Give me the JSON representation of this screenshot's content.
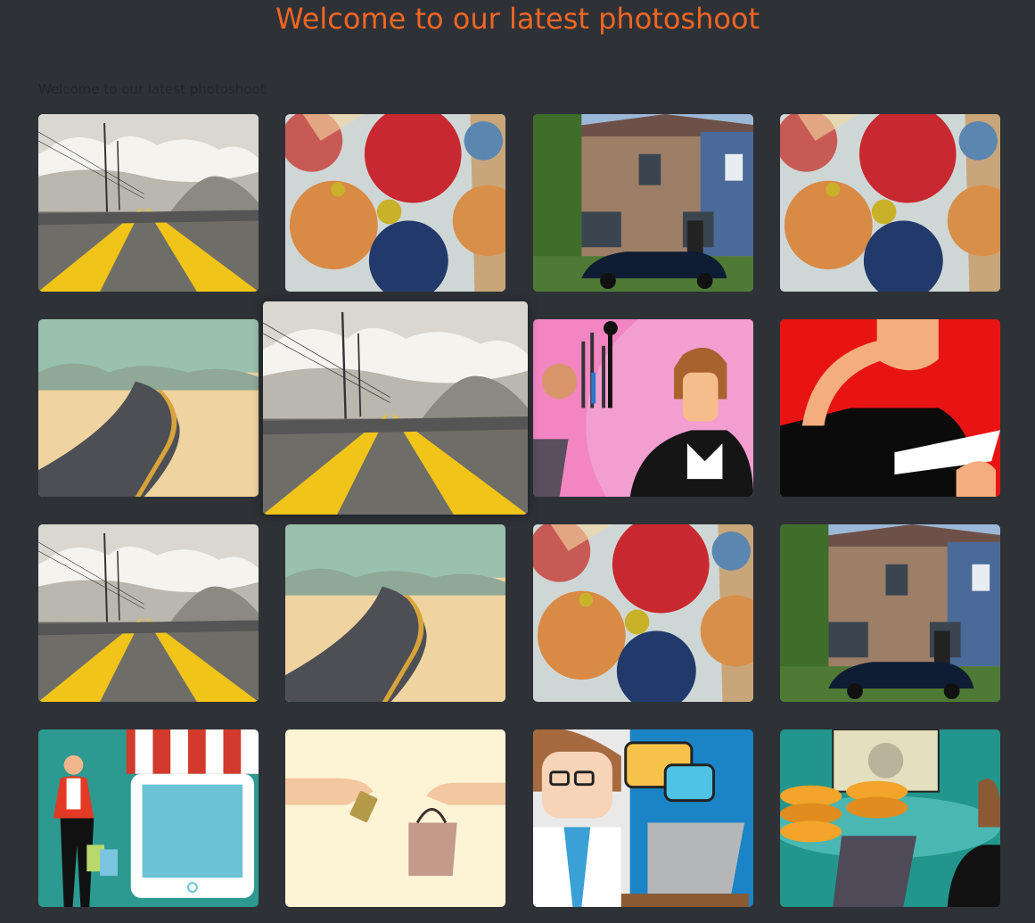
{
  "header": {
    "title": "Welcome to our latest photoshoot"
  },
  "intro": {
    "text": "Welcome to our latest photoshoot"
  },
  "gallery": {
    "photos": [
      {
        "subject": "road-yellow-lines"
      },
      {
        "subject": "umbrellas-sky"
      },
      {
        "subject": "brick-house-car"
      },
      {
        "subject": "umbrellas-sky"
      },
      {
        "subject": "desert-road"
      },
      {
        "subject": "road-yellow-lines",
        "state": "hovered"
      },
      {
        "subject": "businesswoman-makeup"
      },
      {
        "subject": "man-phone-red"
      },
      {
        "subject": "road-yellow-lines"
      },
      {
        "subject": "desert-road"
      },
      {
        "subject": "umbrellas-sky"
      },
      {
        "subject": "brick-house-car"
      },
      {
        "subject": "shopping-woman-tablet"
      },
      {
        "subject": "payment-card-bag"
      },
      {
        "subject": "doctor-laptop"
      },
      {
        "subject": "money-coins-laptop"
      }
    ]
  }
}
